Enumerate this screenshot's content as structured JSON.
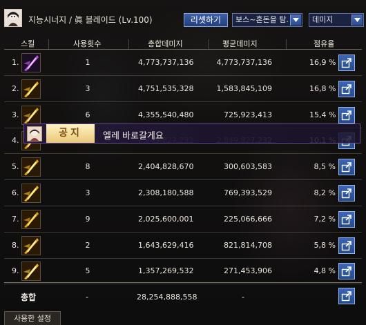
{
  "header": {
    "character": "지능시너지 / 眞 블레이드 (Lv.100)",
    "reset_label": "리셋하기",
    "filter_value": "보스~혼돈을 탐.",
    "sort_value": "데미지"
  },
  "columns": {
    "skill": "스킬",
    "count": "사용횟수",
    "total": "총합데미지",
    "avg": "평균데미지",
    "share": "점유율"
  },
  "rows": [
    {
      "idx": "1.",
      "count": "1",
      "total": "4,773,737,136",
      "avg": "4,773,737,136",
      "share": "16,9 %",
      "icon": "purple-slash-skill-icon"
    },
    {
      "idx": "2.",
      "count": "3",
      "total": "4,751,535,328",
      "avg": "1,583,845,109",
      "share": "16,8 %",
      "icon": "yellow-slash-skill-icon"
    },
    {
      "idx": "3.",
      "count": "6",
      "total": "4,355,540,480",
      "avg": "725,923,413",
      "share": "15,4 %",
      "icon": "yellow-blade-skill-icon"
    },
    {
      "idx": "4.",
      "count": "",
      "total": "2,849,827,232",
      "avg": "2,849,827,232",
      "share": "10,1 %",
      "icon": "yellow-burst-skill-icon"
    },
    {
      "idx": "5.",
      "count": "8",
      "total": "2,404,828,670",
      "avg": "300,603,583",
      "share": "8,5 %",
      "icon": "yellow-strike-skill-icon"
    },
    {
      "idx": "6.",
      "count": "3",
      "total": "2,308,180,588",
      "avg": "769,393,529",
      "share": "8,2 %",
      "icon": "yellow-spin-skill-icon"
    },
    {
      "idx": "7.",
      "count": "9",
      "total": "2,025,600,001",
      "avg": "225,066,666",
      "share": "7,2 %",
      "icon": "yellow-dash-skill-icon"
    },
    {
      "idx": "8.",
      "count": "2",
      "total": "1,643,629,416",
      "avg": "821,814,708",
      "share": "5,8 %",
      "icon": "yellow-wave-skill-icon"
    },
    {
      "idx": "9.",
      "count": "5",
      "total": "1,357,269,532",
      "avg": "271,453,906",
      "share": "4,8 %",
      "icon": "yellow-flash-skill-icon"
    }
  ],
  "total_row": {
    "label": "총합",
    "count": "-",
    "total": "28,254,888,558",
    "avg": "-"
  },
  "footer": {
    "tab": "사용한 설정"
  },
  "notice": {
    "label": "공지",
    "message": "엘레 바로갈게요"
  },
  "colors": {
    "accent_blue": "#2f5aa8",
    "notice_bg": "#281a3c",
    "notice_label": "#e9c878"
  }
}
